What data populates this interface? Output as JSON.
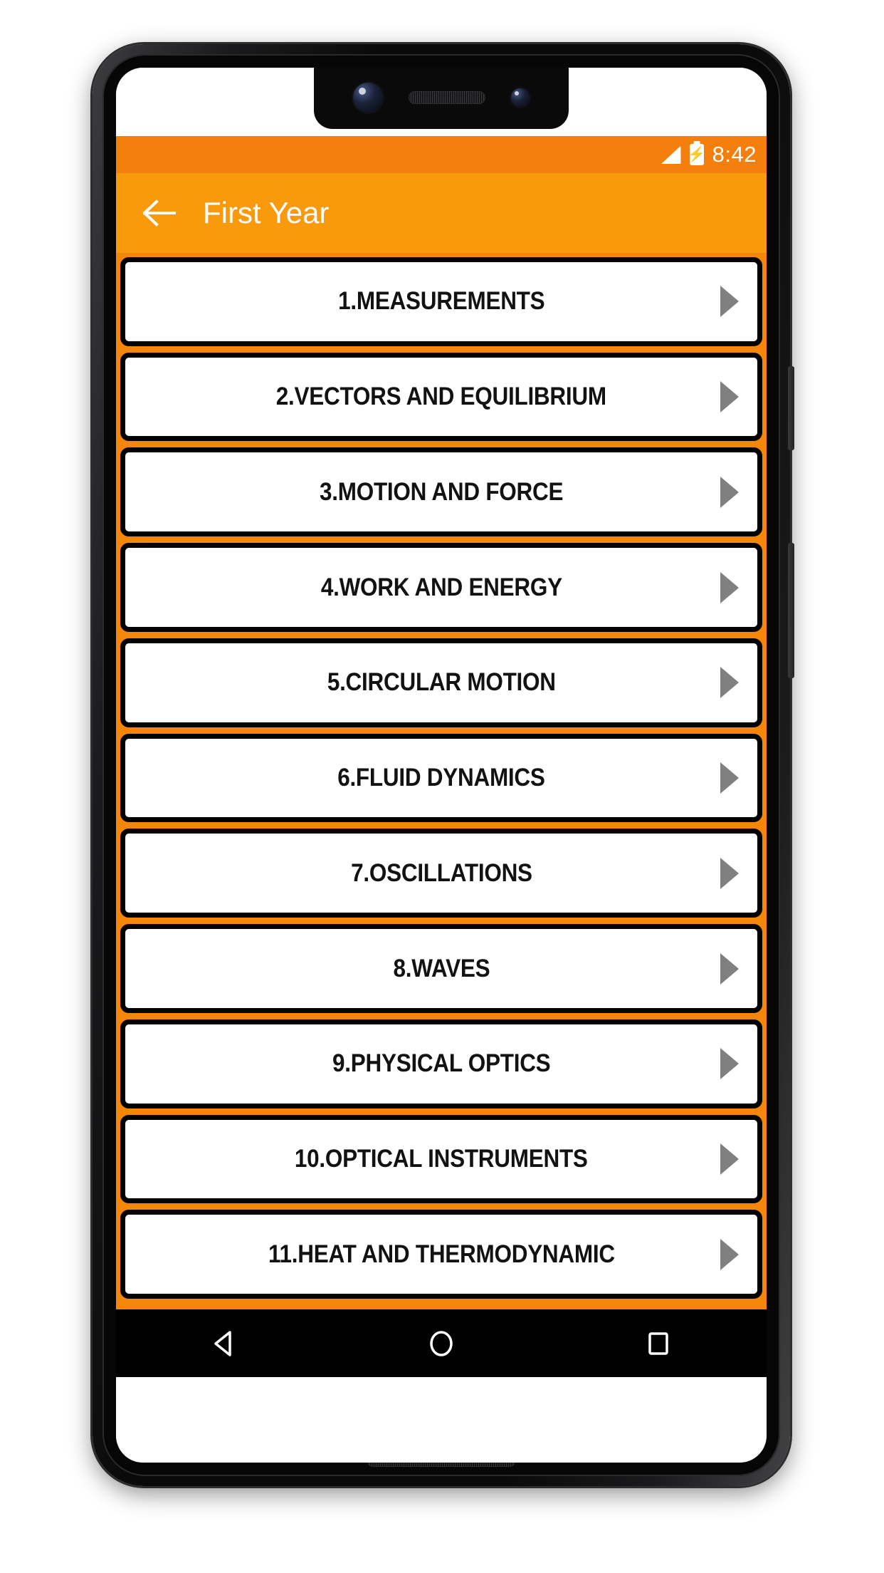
{
  "status_bar": {
    "time": "8:42",
    "signal_icon": "signal-bars-icon",
    "battery_icon": "battery-charging-icon",
    "bolt_glyph": "⚡",
    "background_color": "#F57F0C"
  },
  "app_bar": {
    "title": "First Year",
    "back_icon": "back-arrow-icon",
    "background_color": "#F9990C",
    "title_color": "#FFFFFF"
  },
  "list": {
    "background_color": "#F4860A",
    "chevron_icon": "chevron-right-icon",
    "chevron_color": "#808080",
    "item_border_color": "#000000",
    "item_background_color": "#FFFFFF",
    "items": [
      {
        "label": "1.MEASUREMENTS"
      },
      {
        "label": "2.VECTORS AND EQUILIBRIUM"
      },
      {
        "label": "3.MOTION AND FORCE"
      },
      {
        "label": "4.WORK AND ENERGY"
      },
      {
        "label": "5.CIRCULAR MOTION"
      },
      {
        "label": "6.FLUID DYNAMICS"
      },
      {
        "label": "7.OSCILLATIONS"
      },
      {
        "label": "8.WAVES"
      },
      {
        "label": "9.PHYSICAL OPTICS"
      },
      {
        "label": "10.OPTICAL INSTRUMENTS"
      },
      {
        "label": "11.HEAT AND THERMODYNAMIC"
      }
    ]
  },
  "nav_bar": {
    "background_color": "#000000",
    "buttons": [
      {
        "name": "back-triangle-icon"
      },
      {
        "name": "home-circle-icon"
      },
      {
        "name": "recents-square-icon"
      }
    ]
  },
  "device": {
    "notch": {
      "camera_main_icon": "front-camera-icon",
      "camera_secondary_icon": "front-camera-secondary-icon",
      "earpiece_icon": "earpiece-speaker-icon"
    },
    "power_button": "power-button",
    "volume_button": "volume-rocker-button",
    "bottom_speaker": "bottom-speaker-grille"
  }
}
